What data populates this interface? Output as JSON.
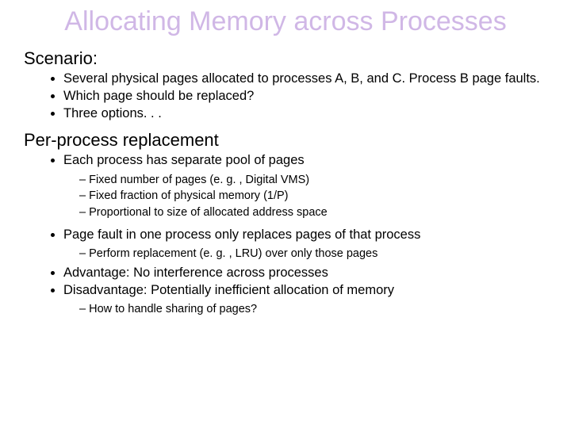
{
  "title": "Allocating Memory across Processes",
  "s1_heading": "Scenario:",
  "s1_b1": "Several physical pages allocated to processes A, B, and C. Process B page faults.",
  "s1_b2": "Which page should be replaced?",
  "s1_b3": "Three options. . .",
  "s2_heading": "Per-process replacement",
  "s2_b1": "Each process has separate pool of pages",
  "s2_b1_s1": "Fixed number of pages (e. g. , Digital VMS)",
  "s2_b1_s2": "Fixed fraction of physical memory (1/P)",
  "s2_b1_s3": "Proportional to size of allocated address space",
  "s2_b2": "Page fault in one process only replaces pages of that process",
  "s2_b2_s1": "Perform replacement (e. g. , LRU) over only those pages",
  "s2_b3": "Advantage: No interference across processes",
  "s2_b4": "Disadvantage: Potentially inefficient allocation of memory",
  "s2_b4_s1": "How to handle sharing of pages?"
}
